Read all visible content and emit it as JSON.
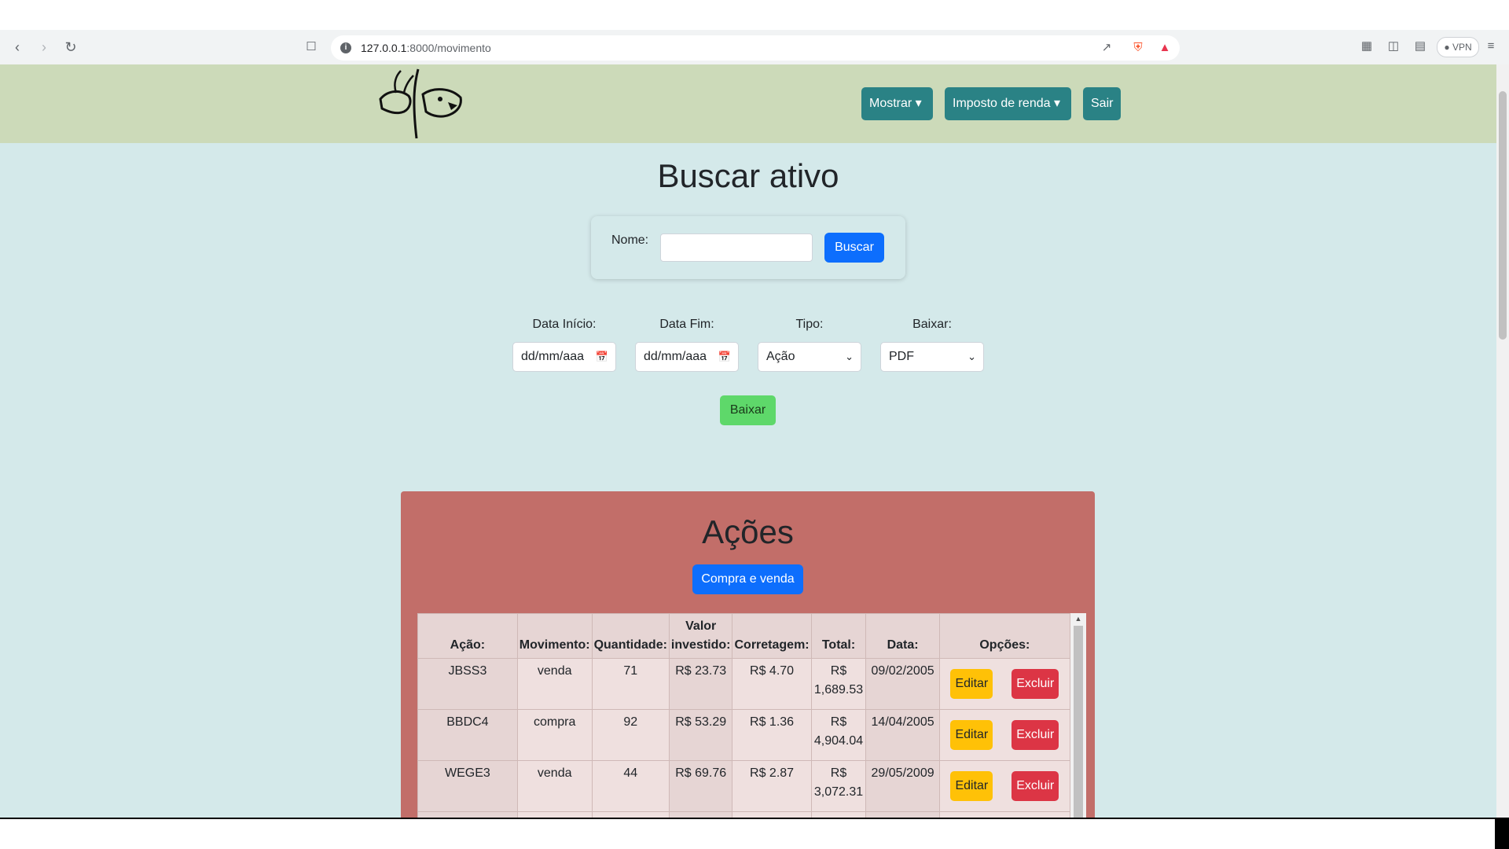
{
  "browser": {
    "url_host": "127.0.0.1",
    "url_path": ":8000/movimento",
    "vpn_label": "VPN",
    "icons": [
      "back-icon",
      "forward-icon",
      "reload-icon",
      "bookmark-icon",
      "site-info-icon",
      "share-icon",
      "brave-shield-icon",
      "brave-rewards-icon",
      "extensions-icon",
      "sidebar-icon",
      "wallet-icon",
      "menu-icon"
    ]
  },
  "header": {
    "buttons": [
      {
        "label": "Mostrar ▾"
      },
      {
        "label": "Imposto de renda ▾"
      },
      {
        "label": "Sair"
      }
    ],
    "color": "#ccdab9",
    "button_color": "#2a8285"
  },
  "page": {
    "title": "Buscar ativo",
    "background": "#d4e9ea"
  },
  "search": {
    "label": "Nome:",
    "value": "",
    "button": "Buscar"
  },
  "filters": {
    "data_inicio_label": "Data Início:",
    "data_inicio_value": "dd/mm/aaa",
    "data_fim_label": "Data Fim:",
    "data_fim_value": "dd/mm/aaa",
    "tipo_label": "Tipo:",
    "tipo_value": "Ação",
    "baixar_label": "Baixar:",
    "baixar_value": "PDF",
    "baixar_button": "Baixar"
  },
  "acoes": {
    "title": "Ações",
    "button": "Compra e venda",
    "columns": [
      "Ação:",
      "Movimento:",
      "Quantidade:",
      "Valor investido:",
      "Corretagem:",
      "Total:",
      "Data:",
      "Opções:"
    ],
    "rows": [
      {
        "acao": "JBSS3",
        "movimento": "venda",
        "quantidade": "71",
        "valor": "R$ 23.73",
        "corretagem": "R$ 4.70",
        "total": "R$ 1,689.53",
        "data": "09/02/2005"
      },
      {
        "acao": "BBDC4",
        "movimento": "compra",
        "quantidade": "92",
        "valor": "R$ 53.29",
        "corretagem": "R$ 1.36",
        "total": "R$ 4,904.04",
        "data": "14/04/2005"
      },
      {
        "acao": "WEGE3",
        "movimento": "venda",
        "quantidade": "44",
        "valor": "R$ 69.76",
        "corretagem": "R$ 2.87",
        "total": "R$ 3,072.31",
        "data": "29/05/2009"
      }
    ],
    "edit_label": "Editar",
    "delete_label": "Excluir"
  }
}
